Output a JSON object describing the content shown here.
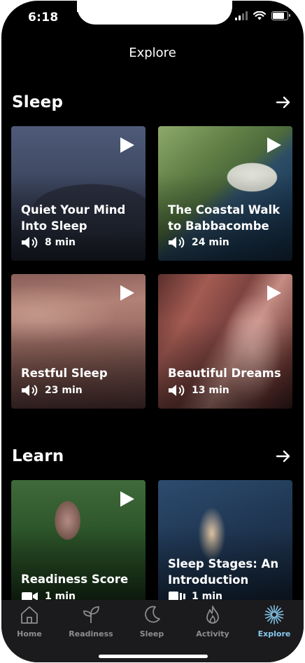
{
  "status_bar": {
    "time": "6:18"
  },
  "header": {
    "title": "Explore"
  },
  "sections": [
    {
      "title": "Sleep",
      "cards": [
        {
          "title_lines": [
            "Quiet Your Mind",
            "Into Sleep"
          ],
          "duration": "8 min",
          "media": "audio"
        },
        {
          "title_lines": [
            "The Coastal Walk",
            "to Babbacombe"
          ],
          "duration": "24 min",
          "media": "audio"
        },
        {
          "title_lines": [
            "Restful Sleep"
          ],
          "duration": "23 min",
          "media": "audio"
        },
        {
          "title_lines": [
            "Beautiful Dreams"
          ],
          "duration": "13 min",
          "media": "audio"
        }
      ]
    },
    {
      "title": "Learn",
      "cards": [
        {
          "title_lines": [
            "Readiness Score"
          ],
          "duration": "1 min",
          "media": "video"
        },
        {
          "title_lines": [
            "Sleep Stages: An",
            "Introduction"
          ],
          "duration": "1 min",
          "media": "slides"
        }
      ]
    }
  ],
  "tab_bar": {
    "items": [
      {
        "label": "Home",
        "icon": "home-icon",
        "active": false
      },
      {
        "label": "Readiness",
        "icon": "sprout-icon",
        "active": false
      },
      {
        "label": "Sleep",
        "icon": "moon-icon",
        "active": false
      },
      {
        "label": "Activity",
        "icon": "flame-icon",
        "active": false
      },
      {
        "label": "Explore",
        "icon": "starburst-icon",
        "active": true
      }
    ],
    "active_color": "#86c9ee",
    "inactive_color": "#8d8d91"
  }
}
